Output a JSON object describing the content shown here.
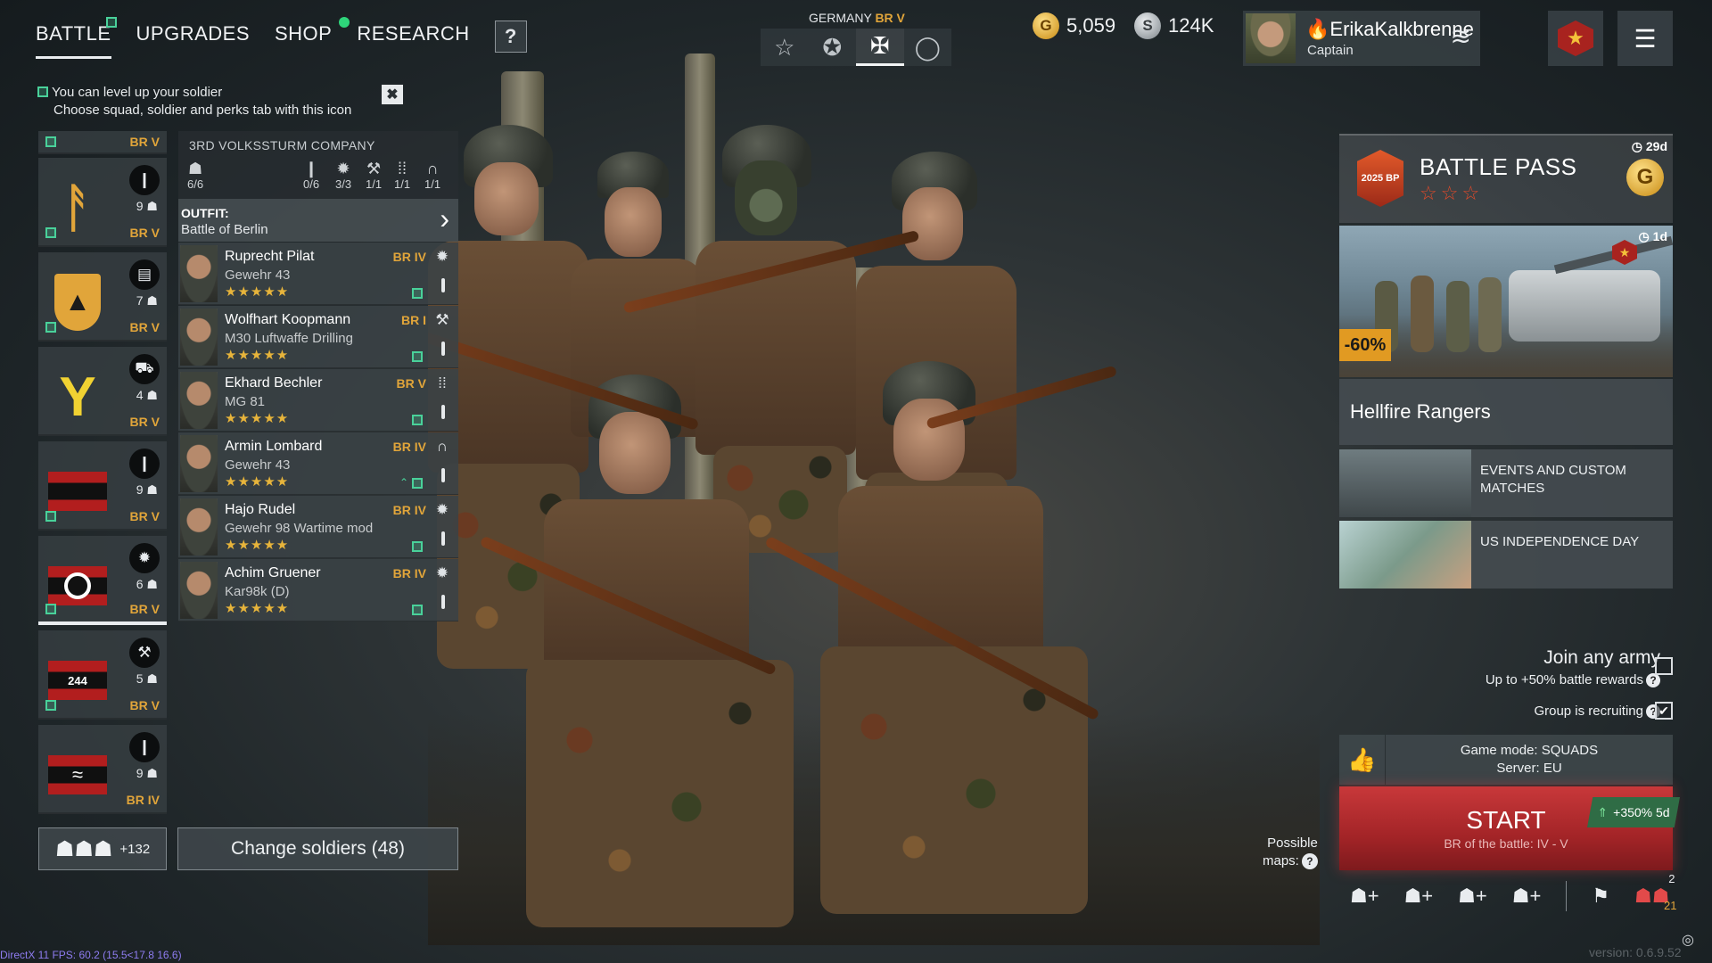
{
  "nav": {
    "tabs": [
      {
        "label": "BATTLE"
      },
      {
        "label": "UPGRADES"
      },
      {
        "label": "SHOP"
      },
      {
        "label": "RESEARCH"
      }
    ],
    "help": "?"
  },
  "hint": {
    "line1": "You can level up your soldier",
    "line2": "Choose squad, soldier and perks tab with this icon",
    "close": "✖"
  },
  "nation": {
    "name": "GERMANY",
    "br": "BR V"
  },
  "currency": {
    "gold": "5,059",
    "silver": "124K"
  },
  "profile": {
    "name": "ErikaKalkbrenne",
    "rank": "Captain"
  },
  "squads": [
    {
      "br": "BR V"
    },
    {
      "count": "9",
      "br": "BR V"
    },
    {
      "count": "7",
      "br": "BR V"
    },
    {
      "count": "4",
      "br": "BR V"
    },
    {
      "count": "9",
      "br": "BR V"
    },
    {
      "count": "6",
      "br": "BR V"
    },
    {
      "count": "5",
      "br": "BR V",
      "badge": "244"
    },
    {
      "count": "9",
      "br": "BR IV"
    }
  ],
  "squad_detail": {
    "name": "3RD VOLKSSTURM COMPANY",
    "stats": [
      "6/6",
      "0/6",
      "3/3",
      "1/1",
      "1/1",
      "1/1"
    ],
    "outfit_label": "OUTFIT:",
    "outfit_value": "Battle of Berlin"
  },
  "soldiers": [
    {
      "name": "Ruprecht Pilat",
      "weapon": "Gewehr 43",
      "br": "BR IV",
      "stars": "★★★★★"
    },
    {
      "name": "Wolfhart Koopmann",
      "weapon": "M30 Luftwaffe Drilling",
      "br": "BR I",
      "stars": "★★★★★"
    },
    {
      "name": "Ekhard Bechler",
      "weapon": "MG 81",
      "br": "BR V",
      "stars": "★★★★★"
    },
    {
      "name": "Armin Lombard",
      "weapon": "Gewehr 43",
      "br": "BR IV",
      "stars": "★★★★★"
    },
    {
      "name": "Hajo Rudel",
      "weapon": "Gewehr 98 Wartime mod",
      "br": "BR IV",
      "stars": "★★★★★"
    },
    {
      "name": "Achim Gruener",
      "weapon": "Kar98k (D)",
      "br": "BR IV",
      "stars": "★★★★★"
    }
  ],
  "reserve": {
    "count": "+132"
  },
  "change_soldiers": "Change soldiers (48)",
  "battle_pass": {
    "title": "BATTLE PASS",
    "timer": "29d",
    "stars": "☆☆☆",
    "icon_text": "2025 BP",
    "coin": "G"
  },
  "promo": {
    "timer": "1d",
    "discount": "-60%",
    "name": "Hellfire Rangers"
  },
  "events": [
    {
      "title": "EVENTS AND CUSTOM MATCHES"
    },
    {
      "title": "US INDEPENDENCE DAY"
    }
  ],
  "join": {
    "title": "Join any army",
    "subtitle": "Up to +50% battle rewards",
    "recruit": "Group is recruiting",
    "recruit_checked": "✔"
  },
  "mode": {
    "line1": "Game mode: SQUADS",
    "line2": "Server: EU"
  },
  "start": {
    "label": "START",
    "br": "BR of the battle: IV - V",
    "xp": "+350% 5d"
  },
  "maps": {
    "label1": "Possible",
    "label2": "maps:"
  },
  "group": {
    "invited": "2",
    "online": "21"
  },
  "footer": {
    "fps": "DirectX 11 FPS: 60.2 (15.5<17.8 16.6)",
    "version": "version: 0.6.9.52"
  },
  "colors": {
    "accent_gold": "#e1a53a",
    "start_red": "#c8383a",
    "green_marker": "#49d19a"
  }
}
